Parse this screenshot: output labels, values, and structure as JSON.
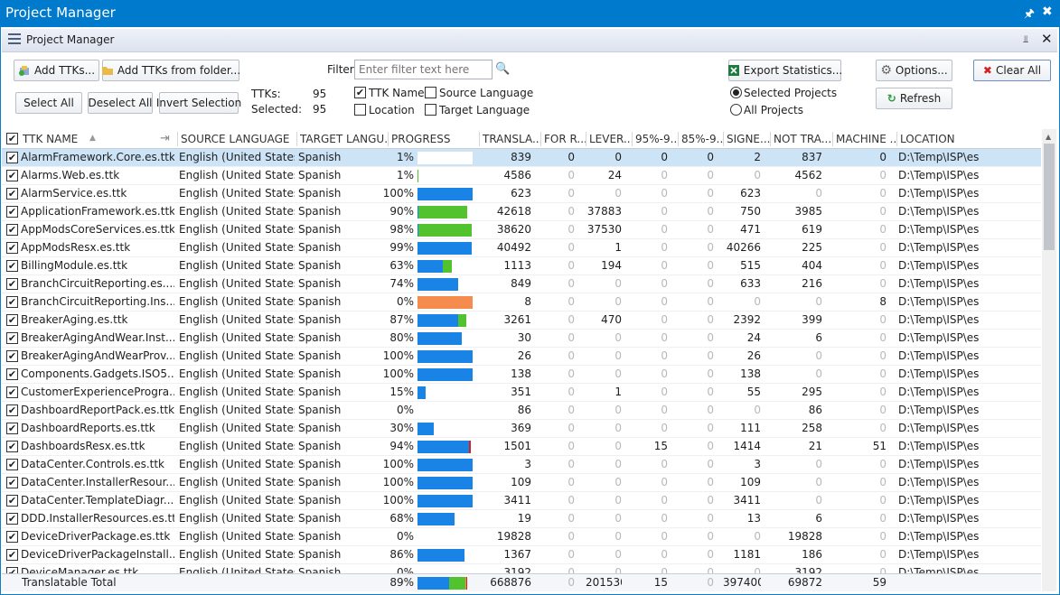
{
  "window": {
    "title": "Project Manager"
  },
  "panel": {
    "title": "Project Manager"
  },
  "toolbar": {
    "add_ttks": "Add TTKs...",
    "add_from_folder": "Add TTKs from folder...",
    "select_all": "Select All",
    "deselect_all": "Deselect All",
    "invert_selection": "Invert Selection",
    "filter_label": "Filter",
    "filter_placeholder": "Enter filter text here",
    "ttks_label": "TTKs:",
    "ttks_value": "95",
    "selected_label": "Selected:",
    "selected_value": "95",
    "ttk_name": "TTK Name",
    "ttk_name_checked": true,
    "location": "Location",
    "source_language": "Source Language",
    "target_language": "Target Language",
    "export_statistics": "Export Statistics...",
    "selected_projects": "Selected Projects",
    "all_projects": "All Projects",
    "options": "Options...",
    "clear_all": "Clear All",
    "refresh": "Refresh"
  },
  "colors": {
    "accent": "#007acc",
    "bar_blue": "#1a84e6",
    "bar_green": "#52c22e",
    "bar_orange": "#f58b4c",
    "bar_red": "#d92020"
  },
  "columns": [
    "TTK NAME",
    "SOURCE LANGUAGE",
    "TARGET LANGU...",
    "PROGRESS",
    "TRANSLA...",
    "FOR R...",
    "LEVER...",
    "95%-9...",
    "85%-9...",
    "SIGNE...",
    "NOT TRA...",
    "MACHINE ...",
    "LOCATION"
  ],
  "rows": [
    {
      "name": "AlarmFramework.Core.es.ttk",
      "src": "English (United States)",
      "tgt": "Spanish",
      "pct": "1%",
      "trans": "839",
      "forr": "0",
      "lever": "0",
      "p95": "0",
      "p85": "0",
      "signed": "2",
      "notrans": "837",
      "machine": "0",
      "loc": "D:\\Temp\\ISP\\es",
      "blue": 0,
      "green": 0,
      "orange": 0,
      "red": 0,
      "outline": true
    },
    {
      "name": "Alarms.Web.es.ttk",
      "src": "English (United States)",
      "tgt": "Spanish",
      "pct": "1%",
      "trans": "4586",
      "forr": "0",
      "lever": "24",
      "p95": "0",
      "p85": "0",
      "signed": "0",
      "notrans": "4562",
      "machine": "0",
      "loc": "D:\\Temp\\ISP\\es",
      "blue": 0,
      "green": 0.01,
      "orange": 0,
      "red": 0
    },
    {
      "name": "AlarmService.es.ttk",
      "src": "English (United States)",
      "tgt": "Spanish",
      "pct": "100%",
      "trans": "623",
      "forr": "0",
      "lever": "0",
      "p95": "0",
      "p85": "0",
      "signed": "623",
      "notrans": "0",
      "machine": "0",
      "loc": "D:\\Temp\\ISP\\es",
      "blue": 1,
      "green": 0,
      "orange": 0,
      "red": 0
    },
    {
      "name": "ApplicationFramework.es.ttk",
      "src": "English (United States)",
      "tgt": "Spanish",
      "pct": "90%",
      "trans": "42618",
      "forr": "0",
      "lever": "37883",
      "p95": "0",
      "p85": "0",
      "signed": "750",
      "notrans": "3985",
      "machine": "0",
      "loc": "D:\\Temp\\ISP\\es",
      "blue": 0.02,
      "green": 0.88,
      "orange": 0,
      "red": 0
    },
    {
      "name": "AppModsCoreServices.es.ttk",
      "src": "English (United States)",
      "tgt": "Spanish",
      "pct": "98%",
      "trans": "38620",
      "forr": "0",
      "lever": "37530",
      "p95": "0",
      "p85": "0",
      "signed": "471",
      "notrans": "619",
      "machine": "0",
      "loc": "D:\\Temp\\ISP\\es",
      "blue": 0.01,
      "green": 0.97,
      "orange": 0,
      "red": 0
    },
    {
      "name": "AppModsResx.es.ttk",
      "src": "English (United States)",
      "tgt": "Spanish",
      "pct": "99%",
      "trans": "40492",
      "forr": "0",
      "lever": "1",
      "p95": "0",
      "p85": "0",
      "signed": "40266",
      "notrans": "225",
      "machine": "0",
      "loc": "D:\\Temp\\ISP\\es",
      "blue": 0.99,
      "green": 0,
      "orange": 0,
      "red": 0
    },
    {
      "name": "BillingModule.es.ttk",
      "src": "English (United States)",
      "tgt": "Spanish",
      "pct": "63%",
      "trans": "1113",
      "forr": "0",
      "lever": "194",
      "p95": "0",
      "p85": "0",
      "signed": "515",
      "notrans": "404",
      "machine": "0",
      "loc": "D:\\Temp\\ISP\\es",
      "blue": 0.46,
      "green": 0.17,
      "orange": 0,
      "red": 0
    },
    {
      "name": "BranchCircuitReporting.es....",
      "src": "English (United States)",
      "tgt": "Spanish",
      "pct": "74%",
      "trans": "849",
      "forr": "0",
      "lever": "0",
      "p95": "0",
      "p85": "0",
      "signed": "633",
      "notrans": "216",
      "machine": "0",
      "loc": "D:\\Temp\\ISP\\es",
      "blue": 0.74,
      "green": 0,
      "orange": 0,
      "red": 0
    },
    {
      "name": "BranchCircuitReporting.Ins...",
      "src": "English (United States)",
      "tgt": "Spanish",
      "pct": "0%",
      "trans": "8",
      "forr": "0",
      "lever": "0",
      "p95": "0",
      "p85": "0",
      "signed": "0",
      "notrans": "0",
      "machine": "8",
      "loc": "D:\\Temp\\ISP\\es",
      "blue": 0,
      "green": 0,
      "orange": 1,
      "red": 0
    },
    {
      "name": "BreakerAging.es.ttk",
      "src": "English (United States)",
      "tgt": "Spanish",
      "pct": "87%",
      "trans": "3261",
      "forr": "0",
      "lever": "470",
      "p95": "0",
      "p85": "0",
      "signed": "2392",
      "notrans": "399",
      "machine": "0",
      "loc": "D:\\Temp\\ISP\\es",
      "blue": 0.73,
      "green": 0.14,
      "orange": 0,
      "red": 0
    },
    {
      "name": "BreakerAgingAndWear.Inst...",
      "src": "English (United States)",
      "tgt": "Spanish",
      "pct": "80%",
      "trans": "30",
      "forr": "0",
      "lever": "0",
      "p95": "0",
      "p85": "0",
      "signed": "24",
      "notrans": "6",
      "machine": "0",
      "loc": "D:\\Temp\\ISP\\es",
      "blue": 0.8,
      "green": 0,
      "orange": 0,
      "red": 0
    },
    {
      "name": "BreakerAgingAndWearProv...",
      "src": "English (United States)",
      "tgt": "Spanish",
      "pct": "100%",
      "trans": "26",
      "forr": "0",
      "lever": "0",
      "p95": "0",
      "p85": "0",
      "signed": "26",
      "notrans": "0",
      "machine": "0",
      "loc": "D:\\Temp\\ISP\\es",
      "blue": 1,
      "green": 0,
      "orange": 0,
      "red": 0
    },
    {
      "name": "Components.Gadgets.ISO5...",
      "src": "English (United States)",
      "tgt": "Spanish",
      "pct": "100%",
      "trans": "138",
      "forr": "0",
      "lever": "0",
      "p95": "0",
      "p85": "0",
      "signed": "138",
      "notrans": "0",
      "machine": "0",
      "loc": "D:\\Temp\\ISP\\es",
      "blue": 1,
      "green": 0,
      "orange": 0,
      "red": 0
    },
    {
      "name": "CustomerExperienceProgra...",
      "src": "English (United States)",
      "tgt": "Spanish",
      "pct": "15%",
      "trans": "351",
      "forr": "0",
      "lever": "1",
      "p95": "0",
      "p85": "0",
      "signed": "55",
      "notrans": "295",
      "machine": "0",
      "loc": "D:\\Temp\\ISP\\es",
      "blue": 0.15,
      "green": 0,
      "orange": 0,
      "red": 0
    },
    {
      "name": "DashboardReportPack.es.ttk",
      "src": "English (United States)",
      "tgt": "Spanish",
      "pct": "0%",
      "trans": "86",
      "forr": "0",
      "lever": "0",
      "p95": "0",
      "p85": "0",
      "signed": "0",
      "notrans": "86",
      "machine": "0",
      "loc": "D:\\Temp\\ISP\\es",
      "blue": 0,
      "green": 0,
      "orange": 0,
      "red": 0
    },
    {
      "name": "DashboardReports.es.ttk",
      "src": "English (United States)",
      "tgt": "Spanish",
      "pct": "30%",
      "trans": "369",
      "forr": "0",
      "lever": "0",
      "p95": "0",
      "p85": "0",
      "signed": "111",
      "notrans": "258",
      "machine": "0",
      "loc": "D:\\Temp\\ISP\\es",
      "blue": 0.3,
      "green": 0,
      "orange": 0,
      "red": 0
    },
    {
      "name": "DashboardsResx.es.ttk",
      "src": "English (United States)",
      "tgt": "Spanish",
      "pct": "94%",
      "trans": "1501",
      "forr": "0",
      "lever": "0",
      "p95": "15",
      "p85": "0",
      "signed": "1414",
      "notrans": "21",
      "machine": "51",
      "loc": "D:\\Temp\\ISP\\es",
      "blue": 0.94,
      "green": 0,
      "orange": 0,
      "red": 0.03
    },
    {
      "name": "DataCenter.Controls.es.ttk",
      "src": "English (United States)",
      "tgt": "Spanish",
      "pct": "100%",
      "trans": "3",
      "forr": "0",
      "lever": "0",
      "p95": "0",
      "p85": "0",
      "signed": "3",
      "notrans": "0",
      "machine": "0",
      "loc": "D:\\Temp\\ISP\\es",
      "blue": 1,
      "green": 0,
      "orange": 0,
      "red": 0
    },
    {
      "name": "DataCenter.InstallerResour...",
      "src": "English (United States)",
      "tgt": "Spanish",
      "pct": "100%",
      "trans": "109",
      "forr": "0",
      "lever": "0",
      "p95": "0",
      "p85": "0",
      "signed": "109",
      "notrans": "0",
      "machine": "0",
      "loc": "D:\\Temp\\ISP\\es",
      "blue": 1,
      "green": 0,
      "orange": 0,
      "red": 0
    },
    {
      "name": "DataCenter.TemplateDiagr...",
      "src": "English (United States)",
      "tgt": "Spanish",
      "pct": "100%",
      "trans": "3411",
      "forr": "0",
      "lever": "0",
      "p95": "0",
      "p85": "0",
      "signed": "3411",
      "notrans": "0",
      "machine": "0",
      "loc": "D:\\Temp\\ISP\\es",
      "blue": 1,
      "green": 0,
      "orange": 0,
      "red": 0
    },
    {
      "name": "DDD.InstallerResources.es.ttk",
      "src": "English (United States)",
      "tgt": "Spanish",
      "pct": "68%",
      "trans": "19",
      "forr": "0",
      "lever": "0",
      "p95": "0",
      "p85": "0",
      "signed": "13",
      "notrans": "6",
      "machine": "0",
      "loc": "D:\\Temp\\ISP\\es",
      "blue": 0.68,
      "green": 0,
      "orange": 0,
      "red": 0
    },
    {
      "name": "DeviceDriverPackage.es.ttk",
      "src": "English (United States)",
      "tgt": "Spanish",
      "pct": "0%",
      "trans": "19828",
      "forr": "0",
      "lever": "0",
      "p95": "0",
      "p85": "0",
      "signed": "0",
      "notrans": "19828",
      "machine": "0",
      "loc": "D:\\Temp\\ISP\\es",
      "blue": 0,
      "green": 0,
      "orange": 0,
      "red": 0
    },
    {
      "name": "DeviceDriverPackageInstall...",
      "src": "English (United States)",
      "tgt": "Spanish",
      "pct": "86%",
      "trans": "1367",
      "forr": "0",
      "lever": "0",
      "p95": "0",
      "p85": "0",
      "signed": "1181",
      "notrans": "186",
      "machine": "0",
      "loc": "D:\\Temp\\ISP\\es",
      "blue": 0.86,
      "green": 0,
      "orange": 0,
      "red": 0
    },
    {
      "name": "DeviceManager.es.ttk",
      "src": "English (United States)",
      "tgt": "Spanish",
      "pct": "0%",
      "trans": "3192",
      "forr": "0",
      "lever": "0",
      "p95": "0",
      "p85": "0",
      "signed": "0",
      "notrans": "3192",
      "machine": "0",
      "loc": "D:\\Temp\\ISP\\es",
      "blue": 0,
      "green": 0,
      "orange": 0,
      "red": 0
    }
  ],
  "footer": {
    "label": "Translatable Total",
    "pct": "89%",
    "trans": "668876",
    "forr": "0",
    "lever": "201530",
    "p95": "15",
    "p85": "0",
    "signed": "397400",
    "notrans": "69872",
    "machine": "59",
    "blue": 0.58,
    "green": 0.3,
    "orange": 0.02,
    "red": 0.01
  }
}
